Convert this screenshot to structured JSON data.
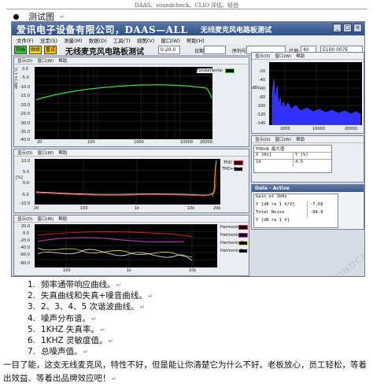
{
  "header": {
    "text": "DAAS、soundcheck、CLIO 评估、经验"
  },
  "section_title": "测试图",
  "return_mark": "↵",
  "app": {
    "title_company": "爱讯电子设备有限公司，DAAS—ALL",
    "title_test": "无线麦克风电路板测试",
    "window_buttons": [
      "_",
      "□",
      "×"
    ],
    "menu": [
      "文件(F)",
      "设定(S)",
      "测量(M)",
      "数据(D)",
      "工具(T)",
      "视图(V)",
      "窗口(W)",
      "帮助(H)"
    ],
    "toolbar": {
      "btn_start": "开始",
      "btn_continue": "继续",
      "btn_repeat": "重试",
      "test_title": "无线麦克风电路板测试",
      "time_value": "0:20.0",
      "label_date": "日期",
      "label_serial": "序列号",
      "label_passed": "已测:",
      "passed_count": "40",
      "right_code": "E100 007E E3DD"
    },
    "pane_menu": [
      "显示(D)",
      "窗口(W)",
      "帮助"
    ],
    "freq_pane": {
      "legend": "Fundamental",
      "ylabel": "dBV [re 1 V]",
      "y_ticks": [
        "0.0",
        "-5.0",
        "-10.0",
        "-15.0",
        "-20.0",
        "-25.0",
        "-30.0",
        "-35.0",
        "-40.0"
      ],
      "x_ticks": [
        "20",
        "100",
        "1000",
        "10000",
        "20000"
      ]
    },
    "thd_pane": {
      "legends": [
        "THD",
        "THD+N"
      ],
      "ylabel": "[%]",
      "y_ticks": [
        "10.0",
        "5.0",
        "0.0",
        "-5.0",
        "-10.0"
      ],
      "x_ticks": [
        "20",
        "100",
        "1k",
        "10k",
        "20k"
      ]
    },
    "harm_pane": {
      "legends": [
        "Harmonic 2",
        "Harmonic 3",
        "Harmonic 4",
        "Harmonic 5"
      ],
      "y_ticks": [
        "20.0",
        "0.0",
        "-20.0",
        "-40.0",
        "-60.0",
        "-80.0"
      ],
      "x_ticks": [
        "100",
        "1k",
        "10k"
      ]
    },
    "spectrum_pane": {
      "ylabel": "dBV",
      "y_ticks": [
        "-20",
        "-40",
        "-60",
        "-80",
        "-100",
        "-120",
        "-140"
      ],
      "x_ticks": [
        "2000",
        "10000",
        "20000"
      ]
    },
    "thd_table": {
      "header_title": "THD+N 最大值",
      "col1": "X [Hz]",
      "col2": "Y [%]",
      "row_x": "1k",
      "row_y": "4.5"
    },
    "data_panel": {
      "title": "Data - Active",
      "gain_label": "Gain at 1kHz",
      "gain_unit": "Y [dB re 1 V/V]",
      "gain_value": "-7.68",
      "noise_label": "Total Noise",
      "noise_unit": "Y [dB re 1 V]",
      "noise_value": "-84.8"
    },
    "watermark": "SOUNDCHECK"
  },
  "list": [
    {
      "num": "1.",
      "text": "频率通带响应曲线。"
    },
    {
      "num": "2.",
      "text": "失真曲线和失真+噪音曲线。"
    },
    {
      "num": "3.",
      "text": "2、3、4、5 次谐波曲线。"
    },
    {
      "num": "4.",
      "text": "噪声分布谱。"
    },
    {
      "num": "5.",
      "text": "1KHZ 失真率。"
    },
    {
      "num": "6.",
      "text": "1KHZ 灵敏度值。"
    },
    {
      "num": "7.",
      "text": "总噪声值。"
    }
  ],
  "paragraph": "一目了能，这支无线麦克风，特性不好，但是能让你清楚它为什么不好。老板放心，员工轻松，等着出效益、等着出品牌效应吧！",
  "colors": {
    "fundamental": "#3ddc3d",
    "thd": "#e02020",
    "thdn": "#d8d8d8",
    "harmonic2": "#e02020",
    "harmonic3": "#c040c0",
    "harmonic4": "#f0e040",
    "harmonic5": "#f0f0f0",
    "spectrum": "#3030ff"
  }
}
